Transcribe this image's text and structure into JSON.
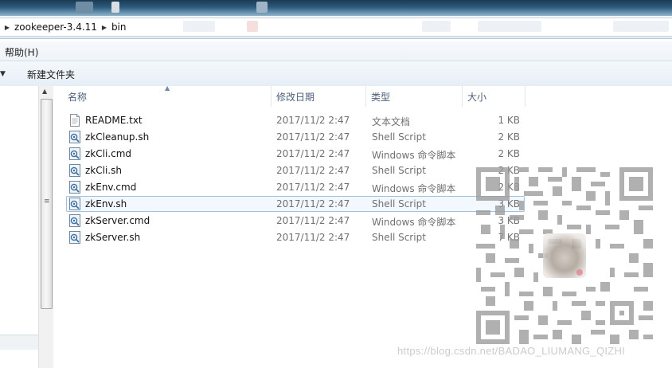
{
  "breadcrumb": {
    "items": [
      "zookeeper-3.4.11",
      "bin"
    ]
  },
  "menubar": {
    "help": "帮助(H)"
  },
  "toolbar": {
    "new_folder": "新建文件夹"
  },
  "columns": {
    "name": "名称",
    "date": "修改日期",
    "type": "类型",
    "size": "大小"
  },
  "files": [
    {
      "name": "README.txt",
      "date": "2017/11/2 2:47",
      "type": "文本文档",
      "size": "1 KB",
      "icon": "text-file-icon"
    },
    {
      "name": "zkCleanup.sh",
      "date": "2017/11/2 2:47",
      "type": "Shell Script",
      "size": "2 KB",
      "icon": "script-file-icon"
    },
    {
      "name": "zkCli.cmd",
      "date": "2017/11/2 2:47",
      "type": "Windows 命令脚本",
      "size": "2 KB",
      "icon": "script-file-icon"
    },
    {
      "name": "zkCli.sh",
      "date": "2017/11/2 2:47",
      "type": "Shell Script",
      "size": "2 KB",
      "icon": "script-file-icon"
    },
    {
      "name": "zkEnv.cmd",
      "date": "2017/11/2 2:47",
      "type": "Windows 命令脚本",
      "size": "2 KB",
      "icon": "script-file-icon"
    },
    {
      "name": "zkEnv.sh",
      "date": "2017/11/2 2:47",
      "type": "Shell Script",
      "size": "3 KB",
      "icon": "script-file-icon",
      "selected": true
    },
    {
      "name": "zkServer.cmd",
      "date": "2017/11/2 2:47",
      "type": "Windows 命令脚本",
      "size": "3 KB",
      "icon": "script-file-icon"
    },
    {
      "name": "zkServer.sh",
      "date": "2017/11/2 2:47",
      "type": "Shell Script",
      "size": "7 KB",
      "icon": "script-file-icon"
    }
  ],
  "watermark": "https://blog.csdn.net/BADAO_LIUMANG_QIZHI",
  "colors": {
    "selection_border": "#9fc3dd",
    "selection_fill": "#f2f8fd",
    "header_text": "#4c607a"
  }
}
